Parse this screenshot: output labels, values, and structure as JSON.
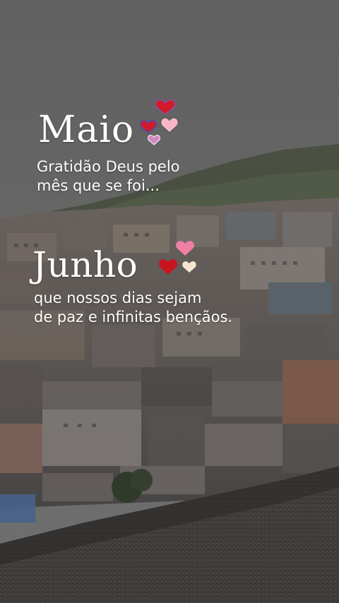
{
  "maio": {
    "title": "Maio",
    "line1": "Gratidão Deus pelo",
    "line2": "mês que se foi..."
  },
  "junho": {
    "title": "Junho",
    "line1": "que nossos dias sejam",
    "line2": "de paz e infinitas bençãos."
  },
  "colors": {
    "sky": "#6e6e6e",
    "hill": "#48503f",
    "text": "#ffffff",
    "heart_red": "#d11a2a",
    "heart_pink": "#f08aa8",
    "heart_cream": "#f4e6cf",
    "heart_purple": "#8a4f9e"
  }
}
